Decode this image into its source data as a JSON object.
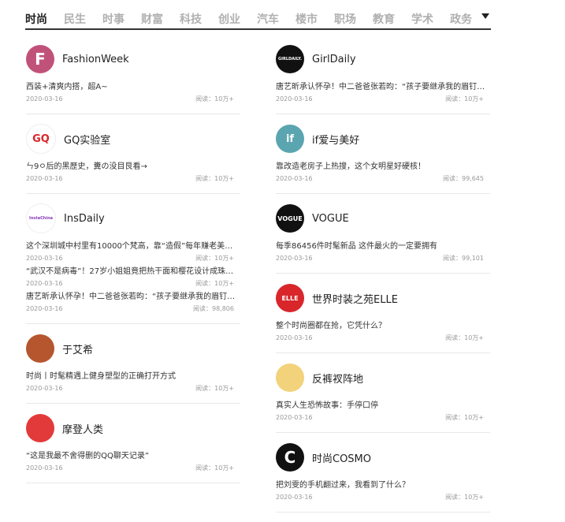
{
  "nav": {
    "tabs": [
      "时尚",
      "民生",
      "时事",
      "财富",
      "科技",
      "创业",
      "汽车",
      "楼市",
      "职场",
      "教育",
      "学术",
      "政务"
    ],
    "active": 0
  },
  "left": [
    {
      "name": "FashionWeek",
      "avatar_color": "#c0527a",
      "avatar_text": "F",
      "articles": [
        {
          "title": "西装+清爽内搭，超A~",
          "date": "2020-03-16",
          "views": "阅读：10万+"
        }
      ]
    },
    {
      "name": "GQ实验室",
      "avatar_color": "#ffffff",
      "avatar_text": "GQ",
      "articles": [
        {
          "title": "ㄣ9ㅇ后的黑歷史，糞の没目艮看→",
          "date": "2020-03-16",
          "views": "阅读：10万+"
        }
      ]
    },
    {
      "name": "InsDaily",
      "avatar_color": "#ffffff",
      "avatar_text": "InstaChina",
      "articles": [
        {
          "title": "这个深圳城中村里有10000个梵高，靠“造假”每年赚老美几十亿…",
          "date": "2020-03-16",
          "views": "阅读：10万+"
        },
        {
          "title": "“武汉不是病毒”！27岁小姐姐竟把热干面和樱花设计成珠宝…",
          "date": "2020-03-16",
          "views": "阅读：10万+"
        },
        {
          "title": "唐艺昕承认怀孕！中二爸爸张若昀：“孩子要继承我的眉钉…",
          "date": "2020-03-16",
          "views": "阅读：98,806"
        }
      ]
    },
    {
      "name": "于艾希",
      "avatar_color": "#b5562f",
      "avatar_text": "",
      "articles": [
        {
          "title": "时尚丨时髦精遇上健身塑型的正确打开方式",
          "date": "2020-03-16",
          "views": "阅读：10万+"
        }
      ]
    },
    {
      "name": "摩登人类",
      "avatar_color": "#e23a3a",
      "avatar_text": "",
      "articles": [
        {
          "title": "“这是我最不舍得删的QQ聊天记录”",
          "date": "2020-03-16",
          "views": "阅读：10万+"
        }
      ]
    }
  ],
  "right": [
    {
      "name": "GirlDaily",
      "avatar_color": "#111111",
      "avatar_text": "GIRLDAILY.",
      "articles": [
        {
          "title": "唐艺昕承认怀孕！中二爸爸张若昀：“孩子要继承我的眉钉…",
          "date": "2020-03-16",
          "views": "阅读：10万+"
        }
      ]
    },
    {
      "name": "if爱与美好",
      "avatar_color": "#5aa5b0",
      "avatar_text": "if",
      "articles": [
        {
          "title": "靠改造老房子上热搜，这个女明星好硬核！",
          "date": "2020-03-16",
          "views": "阅读：99,645"
        }
      ]
    },
    {
      "name": "VOGUE",
      "avatar_color": "#111111",
      "avatar_text": "VOGUE",
      "articles": [
        {
          "title": "每季86456件时髦新品 这件最火的一定要拥有",
          "date": "2020-03-16",
          "views": "阅读：99,101"
        }
      ]
    },
    {
      "name": "世界时装之苑ELLE",
      "avatar_color": "#d8262b",
      "avatar_text": "ELLE",
      "articles": [
        {
          "title": "整个时尚圈都在抢，它凭什么？",
          "date": "2020-03-16",
          "views": "阅读：10万+"
        }
      ]
    },
    {
      "name": "反裤衩阵地",
      "avatar_color": "#f2d27a",
      "avatar_text": "",
      "articles": [
        {
          "title": "真实人生恐怖故事：手停口停",
          "date": "2020-03-16",
          "views": "阅读：10万+"
        }
      ]
    },
    {
      "name": "时尚COSMO",
      "avatar_color": "#111111",
      "avatar_text": "C",
      "articles": [
        {
          "title": "把刘雯的手机翻过来，我看到了什么？",
          "date": "2020-03-16",
          "views": "阅读：10万+"
        }
      ]
    }
  ]
}
